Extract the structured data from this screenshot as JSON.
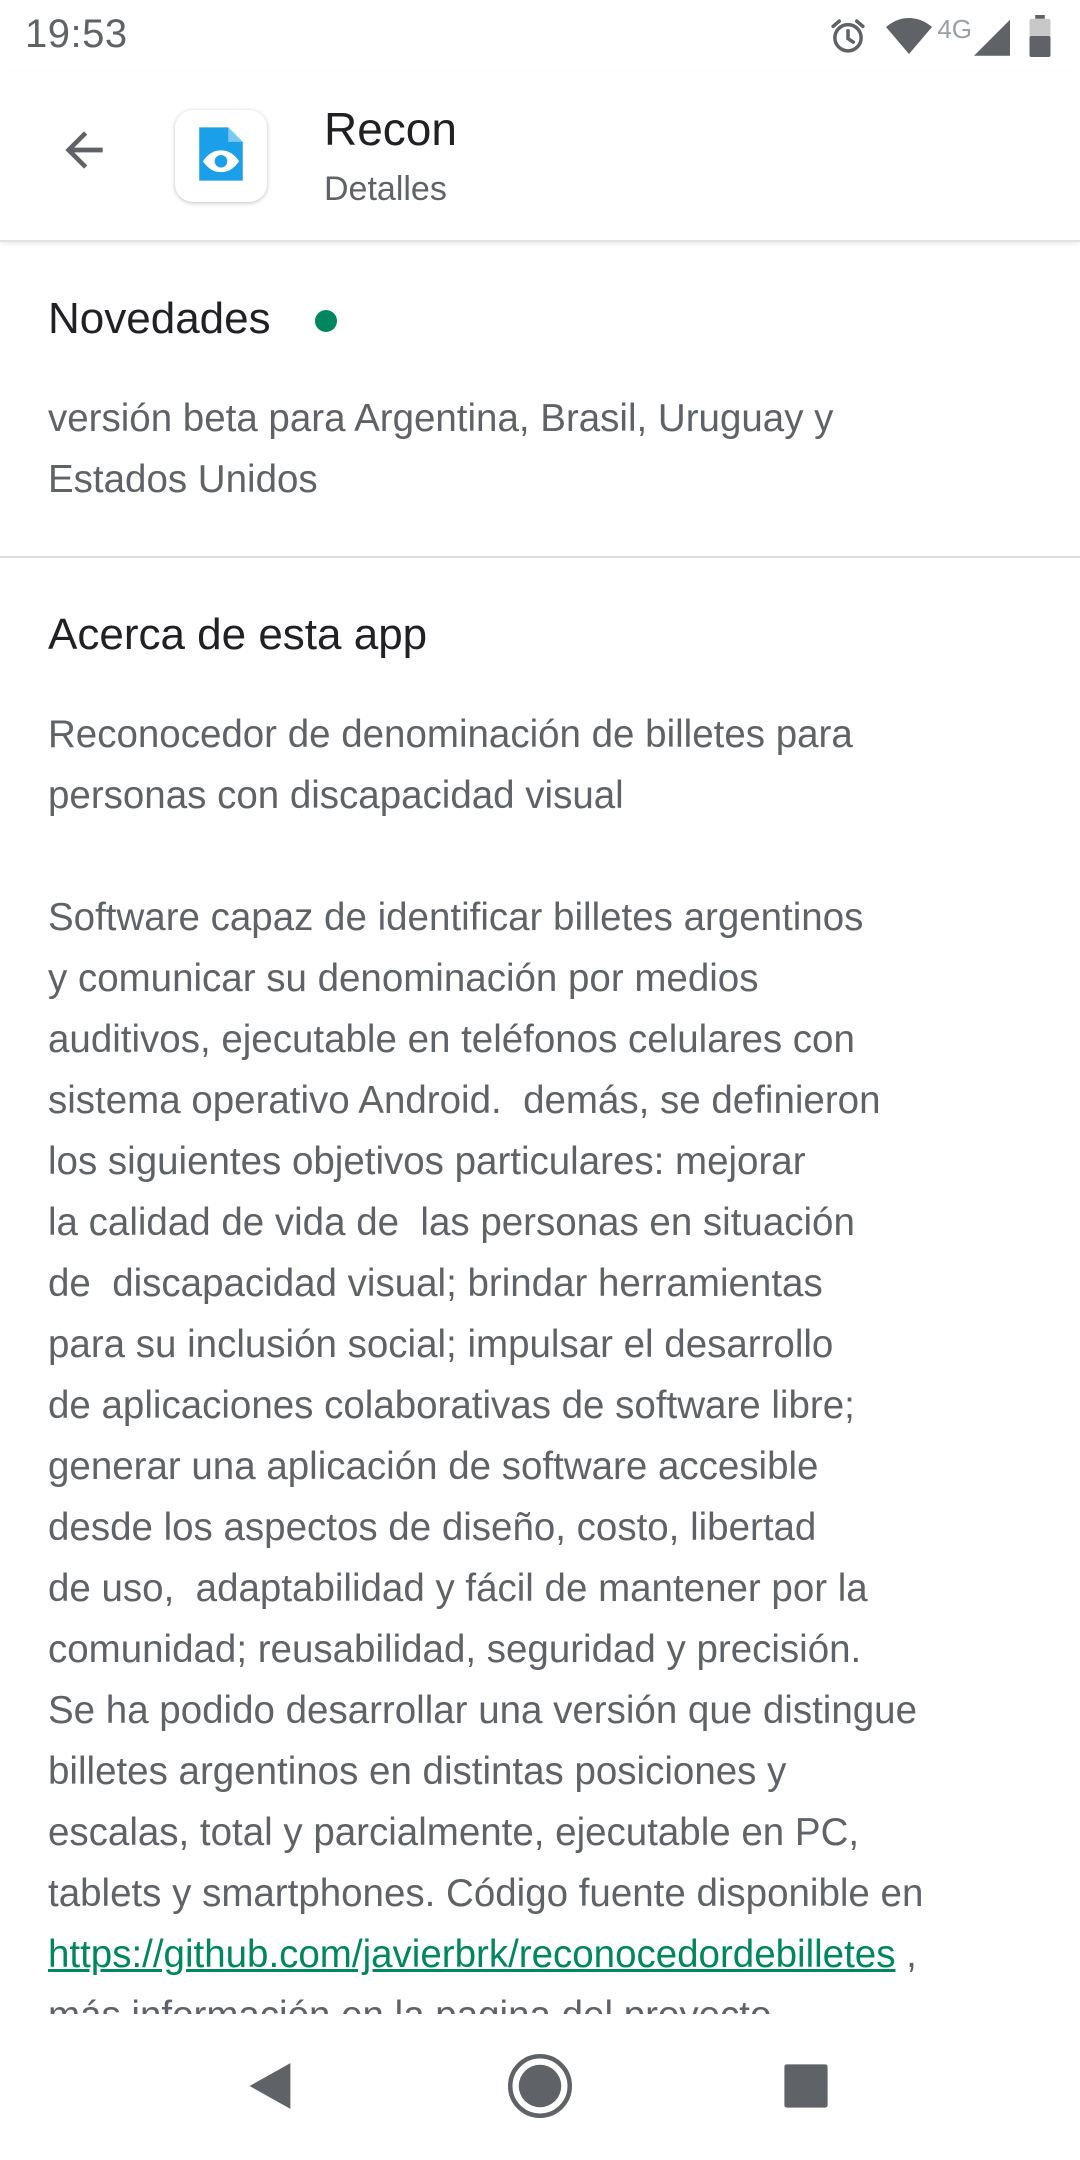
{
  "status_bar": {
    "time": "19:53",
    "network_label": "4G",
    "icons": [
      "alarm-icon",
      "wifi-icon",
      "cellular-signal-icon",
      "battery-icon"
    ]
  },
  "header": {
    "back_icon": "arrow-back-icon",
    "app_icon": "eye-document-icon",
    "title": "Recon",
    "subtitle": "Detalles"
  },
  "whats_new": {
    "heading": "Novedades",
    "dot_color": "#01875f",
    "text": "versión beta para Argentina, Brasil, Uruguay y\nEstados Unidos"
  },
  "about": {
    "heading": "Acerca de esta app",
    "paragraph1": "Reconocedor de denominación de billetes para\npersonas con discapacidad visual",
    "paragraph2": "Software capaz de identificar billetes argentinos\ny comunicar su denominación por medios\nauditivos, ejecutable en teléfonos celulares con\nsistema operativo Android.  demás, se definieron\nlos siguientes objetivos particulares: mejorar\nla calidad de vida de  las personas en situación\nde  discapacidad visual; brindar herramientas\npara su inclusión social; impulsar el desarrollo\nde aplicaciones colaborativas de software libre;\ngenerar una aplicación de software accesible\ndesde los aspectos de diseño, costo, libertad\nde uso,  adaptabilidad y fácil de mantener por la\ncomunidad; reusabilidad, seguridad y precisión.\nSe ha podido desarrollar una versión que distingue\nbilletes argentinos en distintas posiciones y\nescalas, total y parcialmente, ejecutable en PC,\ntablets y smartphones. Código fuente disponible en\n",
    "link_text": "https://github.com/javierbrk/reconocedordebilletes",
    "after_link": " ,\nmás información en la pagina del proyecto",
    "link_color": "#01875f"
  },
  "nav_bar": {
    "back_icon": "nav-back-triangle-icon",
    "home_icon": "nav-home-circle-icon",
    "recents_icon": "nav-recents-square-icon"
  }
}
